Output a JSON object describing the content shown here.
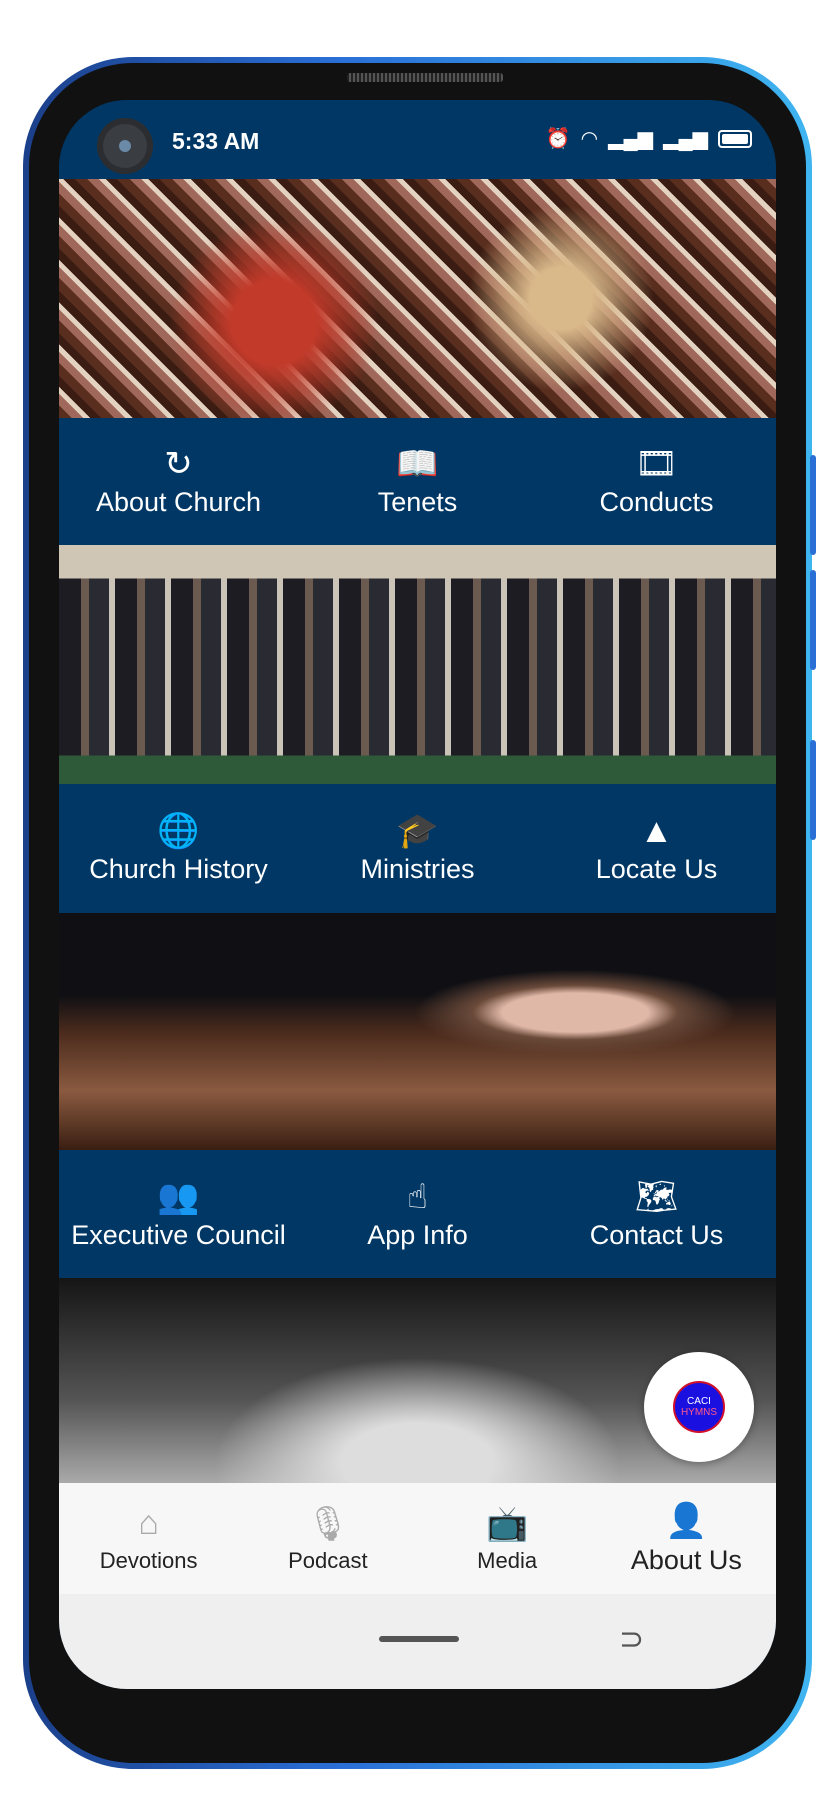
{
  "status_bar": {
    "time": "5:33 AM",
    "icons": [
      "alarm-icon",
      "wifi-icon",
      "signal-icon",
      "signal-icon",
      "battery-icon"
    ]
  },
  "menu_rows": [
    [
      {
        "label": "About Church",
        "icon": "history-icon",
        "glyph": "↻"
      },
      {
        "label": "Tenets",
        "icon": "book-reader-icon",
        "glyph": "📖"
      },
      {
        "label": "Conducts",
        "icon": "film-icon",
        "glyph": "🎞"
      }
    ],
    [
      {
        "label": "Church History",
        "icon": "globe-icon",
        "glyph": "🌐"
      },
      {
        "label": "Ministries",
        "icon": "graduation-cap-icon",
        "glyph": "🎓"
      },
      {
        "label": "Locate Us",
        "icon": "mountains-icon",
        "glyph": "▲"
      }
    ],
    [
      {
        "label": "Executive Council",
        "icon": "users-icon",
        "glyph": "👥"
      },
      {
        "label": "App Info",
        "icon": "hand-pointer-icon",
        "glyph": "☝"
      },
      {
        "label": "Contact Us",
        "icon": "map-icon",
        "glyph": "🗺"
      }
    ]
  ],
  "fab": {
    "logo_line1": "CACI",
    "logo_line2": "HYMNS"
  },
  "bottom_nav": [
    {
      "label": "Devotions",
      "icon": "home-icon",
      "glyph": "⌂",
      "active": false
    },
    {
      "label": "Podcast",
      "icon": "microphone-icon",
      "glyph": "🎙",
      "active": false
    },
    {
      "label": "Media",
      "icon": "tv-play-icon",
      "glyph": "📺",
      "active": false
    },
    {
      "label": "About Us",
      "icon": "account-box-icon",
      "glyph": "👤",
      "active": true
    }
  ],
  "colors": {
    "primary": "#003764",
    "nav_bg": "#f7f7f7"
  }
}
